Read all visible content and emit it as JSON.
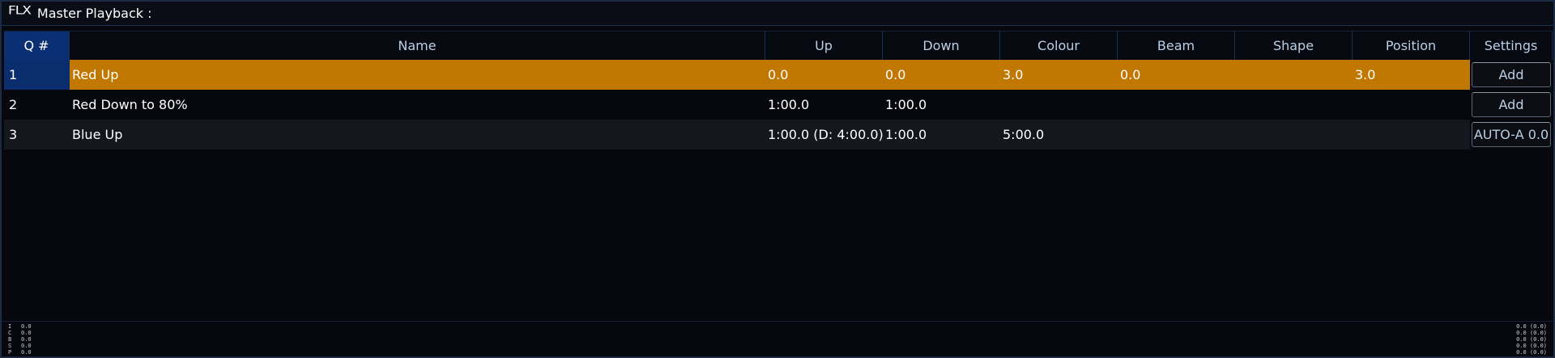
{
  "window": {
    "logo": "FLX",
    "title": "Master Playback :"
  },
  "table": {
    "headers": {
      "q": "Q #",
      "name": "Name",
      "up": "Up",
      "down": "Down",
      "colour": "Colour",
      "beam": "Beam",
      "shape": "Shape",
      "position": "Position",
      "settings": "Settings"
    },
    "rows": [
      {
        "q": "1",
        "name": "Red Up",
        "up": "0.0",
        "down": "0.0",
        "colour": "3.0",
        "beam": "0.0",
        "shape": "",
        "position": "3.0",
        "settings": "Add"
      },
      {
        "q": "2",
        "name": "Red Down to 80%",
        "up": "1:00.0",
        "down": "1:00.0",
        "colour": "",
        "beam": "",
        "shape": "",
        "position": "",
        "settings": "Add"
      },
      {
        "q": "3",
        "name": "Blue Up",
        "up": "1:00.0 (D: 4:00.0)",
        "down": "1:00.0",
        "colour": "5:00.0",
        "beam": "",
        "shape": "",
        "position": "",
        "settings": "AUTO-A 0.0"
      }
    ]
  },
  "footer": {
    "left": [
      {
        "label": "I",
        "value": "0.0"
      },
      {
        "label": "C",
        "value": "0.0"
      },
      {
        "label": "B",
        "value": "0.0"
      },
      {
        "label": "S",
        "value": "0.0"
      },
      {
        "label": "P",
        "value": "0.0"
      }
    ],
    "right": [
      "0.0 (0.0)",
      "0.0 (0.0)",
      "0.0 (0.0)",
      "0.0 (0.0)",
      "0.0 (0.0)"
    ]
  },
  "colors": {
    "active_row": "#c17800",
    "q_header": "#0b2f73",
    "header_text": "#b9d0e6"
  }
}
